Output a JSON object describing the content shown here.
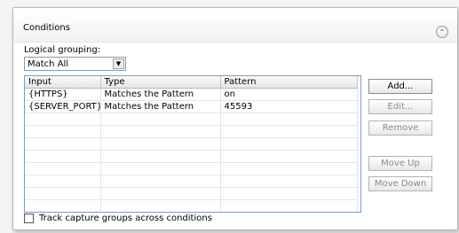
{
  "panel": {
    "title": "Conditions",
    "collapse_icon": "chevron-up-icon"
  },
  "grouping": {
    "label": "Logical grouping:",
    "selected": "Match All"
  },
  "grid": {
    "columns": [
      "Input",
      "Type",
      "Pattern"
    ],
    "rows": [
      {
        "input": "{HTTPS}",
        "type": "Matches the Pattern",
        "pattern": "on"
      },
      {
        "input": "{SERVER_PORT}",
        "type": "Matches the Pattern",
        "pattern": "45593"
      }
    ]
  },
  "buttons": {
    "add": "Add...",
    "edit": "Edit...",
    "remove": "Remove",
    "move_up": "Move Up",
    "move_down": "Move Down"
  },
  "track_option": {
    "label": "Track capture groups across conditions",
    "checked": false
  }
}
